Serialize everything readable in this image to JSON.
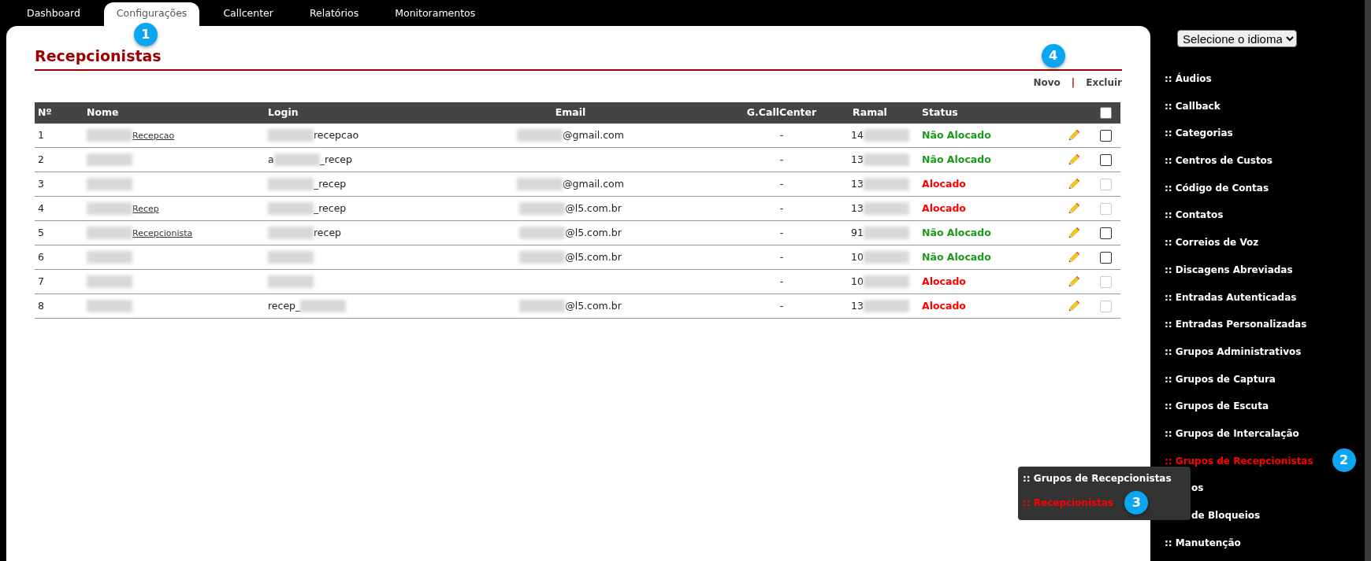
{
  "tabs": [
    {
      "label": "Dashboard",
      "selected": false
    },
    {
      "label": "Configurações",
      "selected": true,
      "callout": "1"
    },
    {
      "label": "Callcenter",
      "selected": false
    },
    {
      "label": "Relatórios",
      "selected": false
    },
    {
      "label": "Monitoramentos",
      "selected": false
    }
  ],
  "page_title": "Recepcionistas",
  "actions": {
    "new": "Novo",
    "separator": "|",
    "delete": "Excluir",
    "callout": "4"
  },
  "table": {
    "columns": [
      "Nº",
      "Nome",
      "Login",
      "Email",
      "G.CallCenter",
      "Ramal",
      "Status"
    ],
    "select_all_checked": false,
    "rows": [
      {
        "no": "1",
        "name": {
          "link": true,
          "parts": [
            {
              "blurred": true
            },
            {
              "text": "Recepcao"
            }
          ]
        },
        "login": {
          "parts": [
            {
              "blurred": true
            },
            {
              "text": "recepcao"
            }
          ]
        },
        "email": {
          "parts": [
            {
              "blurred": true
            },
            {
              "text": "@gmail.com"
            }
          ]
        },
        "group": "-",
        "ramal": {
          "parts": [
            {
              "text": "14"
            },
            {
              "blurred": true
            }
          ]
        },
        "status": "Não Alocado",
        "allocated": false,
        "disabled": false
      },
      {
        "no": "2",
        "name": {
          "parts": [
            {
              "blurred": true
            }
          ]
        },
        "login": {
          "parts": [
            {
              "text": "a"
            },
            {
              "blurred": true
            },
            {
              "text": "_recep"
            }
          ]
        },
        "group": "-",
        "ramal": {
          "parts": [
            {
              "text": "13"
            },
            {
              "blurred": true
            }
          ]
        },
        "status": "Não Alocado",
        "allocated": false,
        "disabled": false
      },
      {
        "no": "3",
        "name": {
          "parts": [
            {
              "blurred": true
            }
          ]
        },
        "login": {
          "parts": [
            {
              "blurred": true
            },
            {
              "text": "_recep"
            }
          ]
        },
        "email": {
          "parts": [
            {
              "blurred": true
            },
            {
              "text": "@gmail.com"
            }
          ]
        },
        "group": "-",
        "ramal": {
          "parts": [
            {
              "text": "13"
            },
            {
              "blurred": true
            }
          ]
        },
        "status": "Alocado",
        "allocated": true,
        "disabled": true
      },
      {
        "no": "4",
        "name": {
          "link": true,
          "parts": [
            {
              "blurred": true
            },
            {
              "text": "Recep"
            }
          ]
        },
        "login": {
          "parts": [
            {
              "blurred": true
            },
            {
              "text": "_recep"
            }
          ]
        },
        "email": {
          "parts": [
            {
              "blurred": true
            },
            {
              "text": "@l5.com.br"
            }
          ]
        },
        "group": "-",
        "ramal": {
          "parts": [
            {
              "text": "13"
            },
            {
              "blurred": true
            }
          ]
        },
        "status": "Alocado",
        "allocated": true,
        "disabled": true
      },
      {
        "no": "5",
        "name": {
          "link": true,
          "parts": [
            {
              "blurred": true
            },
            {
              "text": "Recepcionista"
            }
          ]
        },
        "login": {
          "parts": [
            {
              "blurred": true
            },
            {
              "text": "recep"
            }
          ]
        },
        "email": {
          "parts": [
            {
              "blurred": true
            },
            {
              "text": "@l5.com.br"
            }
          ]
        },
        "group": "-",
        "ramal": {
          "parts": [
            {
              "text": "91"
            },
            {
              "blurred": true
            }
          ]
        },
        "status": "Não Alocado",
        "allocated": false,
        "disabled": false
      },
      {
        "no": "6",
        "name": {
          "parts": [
            {
              "blurred": true
            }
          ]
        },
        "login": {
          "parts": [
            {
              "blurred": true
            }
          ]
        },
        "email": {
          "parts": [
            {
              "blurred": true
            },
            {
              "text": "@l5.com.br"
            }
          ]
        },
        "group": "-",
        "ramal": {
          "parts": [
            {
              "text": "10"
            },
            {
              "blurred": true
            }
          ]
        },
        "status": "Não Alocado",
        "allocated": false,
        "disabled": false
      },
      {
        "no": "7",
        "name": {
          "parts": [
            {
              "blurred": true
            }
          ]
        },
        "login": {
          "parts": [
            {
              "blurred": true
            }
          ]
        },
        "group": "-",
        "ramal": {
          "parts": [
            {
              "text": "10"
            },
            {
              "blurred": true
            }
          ]
        },
        "status": "Alocado",
        "allocated": true,
        "disabled": true
      },
      {
        "no": "8",
        "name": {
          "parts": [
            {
              "blurred": true
            }
          ]
        },
        "login": {
          "parts": [
            {
              "text": "recep_"
            },
            {
              "blurred": true
            }
          ]
        },
        "email": {
          "parts": [
            {
              "blurred": true
            },
            {
              "text": "@l5.com.br"
            }
          ]
        },
        "group": "-",
        "ramal": {
          "parts": [
            {
              "text": "13"
            },
            {
              "blurred": true
            }
          ]
        },
        "status": "Alocado",
        "allocated": true,
        "disabled": true
      }
    ]
  },
  "language_select": "Selecione o idioma",
  "sidebar": {
    "items": [
      {
        "label": ":: Áudios",
        "selected": false
      },
      {
        "label": ":: Callback",
        "selected": false
      },
      {
        "label": ":: Categorias",
        "selected": false
      },
      {
        "label": ":: Centros de Custos",
        "selected": false
      },
      {
        "label": ":: Código de Contas",
        "selected": false
      },
      {
        "label": ":: Contatos",
        "selected": false
      },
      {
        "label": ":: Correios de Voz",
        "selected": false
      },
      {
        "label": ":: Discagens Abreviadas",
        "selected": false
      },
      {
        "label": ":: Entradas Autenticadas",
        "selected": false
      },
      {
        "label": ":: Entradas Personalizadas",
        "selected": false
      },
      {
        "label": ":: Grupos Administrativos",
        "selected": false
      },
      {
        "label": ":: Grupos de Captura",
        "selected": false
      },
      {
        "label": ":: Grupos de Escuta",
        "selected": false
      },
      {
        "label": ":: Grupos de Intercalação",
        "selected": false
      },
      {
        "label": ":: Grupos de Recepcionistas",
        "selected": true,
        "callout": "2"
      },
      {
        "label": "os",
        "selected": false,
        "occluded": true
      },
      {
        "label": "de Bloqueios",
        "selected": false,
        "occluded": true
      },
      {
        "label": ":: Manutenção",
        "selected": false
      }
    ]
  },
  "submenu": {
    "items": [
      {
        "label": ":: Grupos de Recepcionistas",
        "selected": false
      },
      {
        "label": ":: Recepcionistas",
        "selected": true,
        "callout": "3"
      }
    ]
  }
}
